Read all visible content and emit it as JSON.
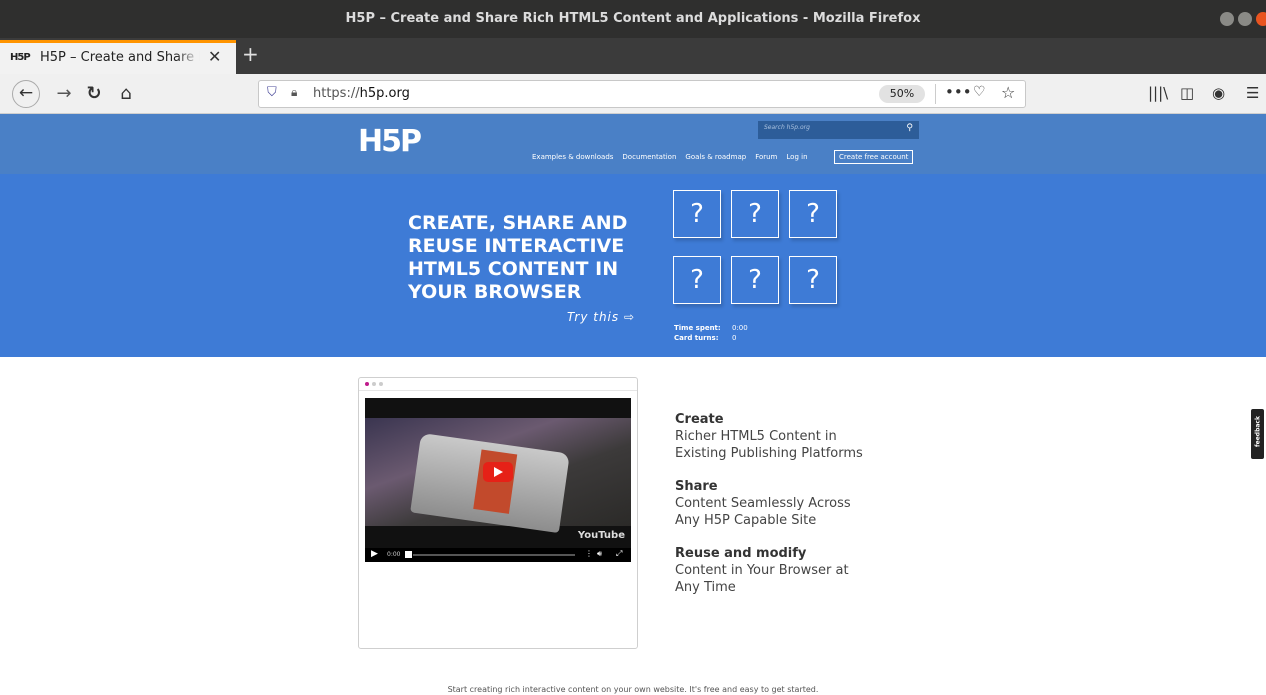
{
  "window": {
    "title": "H5P – Create and Share Rich HTML5 Content and Applications - Mozilla Firefox"
  },
  "tab": {
    "favicon": "H5P",
    "title": "H5P – Create and Share Rich HTML5 Content and Applications",
    "close": "✕"
  },
  "newtab": "+",
  "toolbar": {
    "url_prefix": "https://",
    "url_host": "h5p.org",
    "zoom": "50%",
    "more": "•••"
  },
  "site": {
    "logo": "H5P",
    "search_placeholder": "Search h5p.org",
    "nav": [
      "Examples & downloads",
      "Documentation",
      "Goals & roadmap",
      "Forum",
      "Log in"
    ],
    "create_account": "Create free account"
  },
  "hero": {
    "headline": "CREATE, SHARE AND REUSE INTERACTIVE HTML5 CONTENT IN YOUR BROWSER",
    "try_this": "Try this ⇨",
    "card_symbol": "?",
    "time_spent_label": "Time spent:",
    "time_spent_value": "0:00",
    "card_turns_label": "Card turns:",
    "card_turns_value": "0"
  },
  "video": {
    "time": "0:00",
    "logo": "YouTube",
    "progress": 0
  },
  "features": [
    {
      "title": "Create",
      "text": "Richer HTML5 Content in Existing Publishing Platforms"
    },
    {
      "title": "Share",
      "text": "Content Seamlessly Across Any H5P Capable Site"
    },
    {
      "title": "Reuse and modify",
      "text": "Content in Your Browser at Any Time"
    }
  ],
  "feedback": "feedback",
  "footer": "Start creating rich interactive content on your own website. It's free and easy to get started.",
  "colors": {
    "header": "#4a80c6",
    "hero": "#3e7bd6",
    "tab_accent": "#ff9400"
  }
}
